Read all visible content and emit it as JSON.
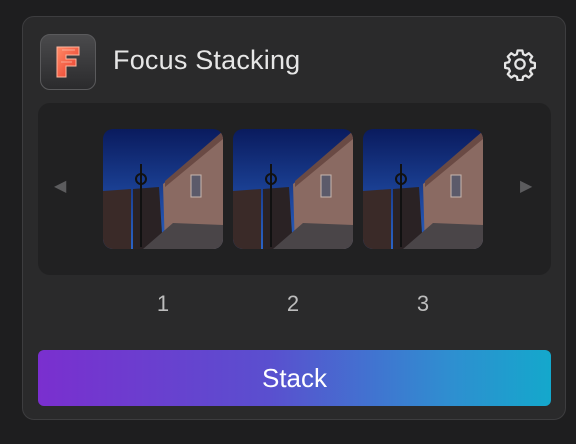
{
  "app": {
    "title": "Focus Stacking",
    "icon_letter": "F"
  },
  "icons": {
    "settings": "gear-icon",
    "prev": "chevron-left-icon",
    "next": "chevron-right-icon"
  },
  "carousel": {
    "prev_glyph": "◀",
    "next_glyph": "▶",
    "images": [
      {
        "label": "1"
      },
      {
        "label": "2"
      },
      {
        "label": "3"
      }
    ]
  },
  "actions": {
    "stack_label": "Stack"
  },
  "colors": {
    "button_gradient_start": "#7a2fcf",
    "button_gradient_end": "#14a8cc",
    "icon_accent": "#ff6a4d"
  }
}
